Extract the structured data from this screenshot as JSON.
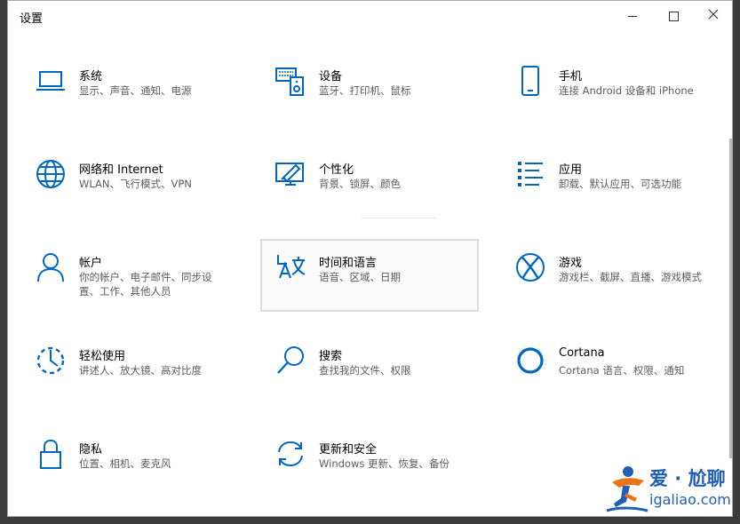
{
  "window": {
    "title": "设置",
    "minimize_icon": "minimize-icon",
    "maximize_icon": "maximize-icon",
    "close_icon": "close-icon"
  },
  "accent": "#0067c0",
  "tiles": [
    {
      "name": "系统",
      "desc": "显示、声音、通知、电源",
      "icon": "laptop-icon"
    },
    {
      "name": "设备",
      "desc": "蓝牙、打印机、鼠标",
      "icon": "devices-icon"
    },
    {
      "name": "手机",
      "desc": "连接 Android 设备和 iPhone",
      "icon": "phone-icon"
    },
    {
      "name": "网络和 Internet",
      "desc": "WLAN、飞行模式、VPN",
      "icon": "globe-icon"
    },
    {
      "name": "个性化",
      "desc": "背景、锁屏、颜色",
      "icon": "personalization-icon"
    },
    {
      "name": "应用",
      "desc": "卸载、默认应用、可选功能",
      "icon": "apps-list-icon"
    },
    {
      "name": "帐户",
      "desc": "你的帐户、电子邮件、同步设置、工作、其他人员",
      "icon": "person-icon"
    },
    {
      "name": "时间和语言",
      "desc": "语音、区域、日期",
      "icon": "time-language-icon"
    },
    {
      "name": "游戏",
      "desc": "游戏栏、截屏、直播、游戏模式",
      "icon": "xbox-icon"
    },
    {
      "name": "轻松使用",
      "desc": "讲述人、放大镜、高对比度",
      "icon": "ease-of-access-icon"
    },
    {
      "name": "搜索",
      "desc": "查找我的文件、权限",
      "icon": "search-icon"
    },
    {
      "name": "Cortana",
      "desc": "Cortana 语言、权限、通知",
      "icon": "cortana-icon"
    },
    {
      "name": "隐私",
      "desc": "位置、相机、麦克风",
      "icon": "lock-icon"
    },
    {
      "name": "更新和安全",
      "desc": "Windows 更新、恢复、备份",
      "icon": "update-sync-icon"
    }
  ],
  "watermark": {
    "cn": "爱 · 尬聊",
    "en": "igaliao.com",
    "figure_icon": "mascot-icon"
  }
}
